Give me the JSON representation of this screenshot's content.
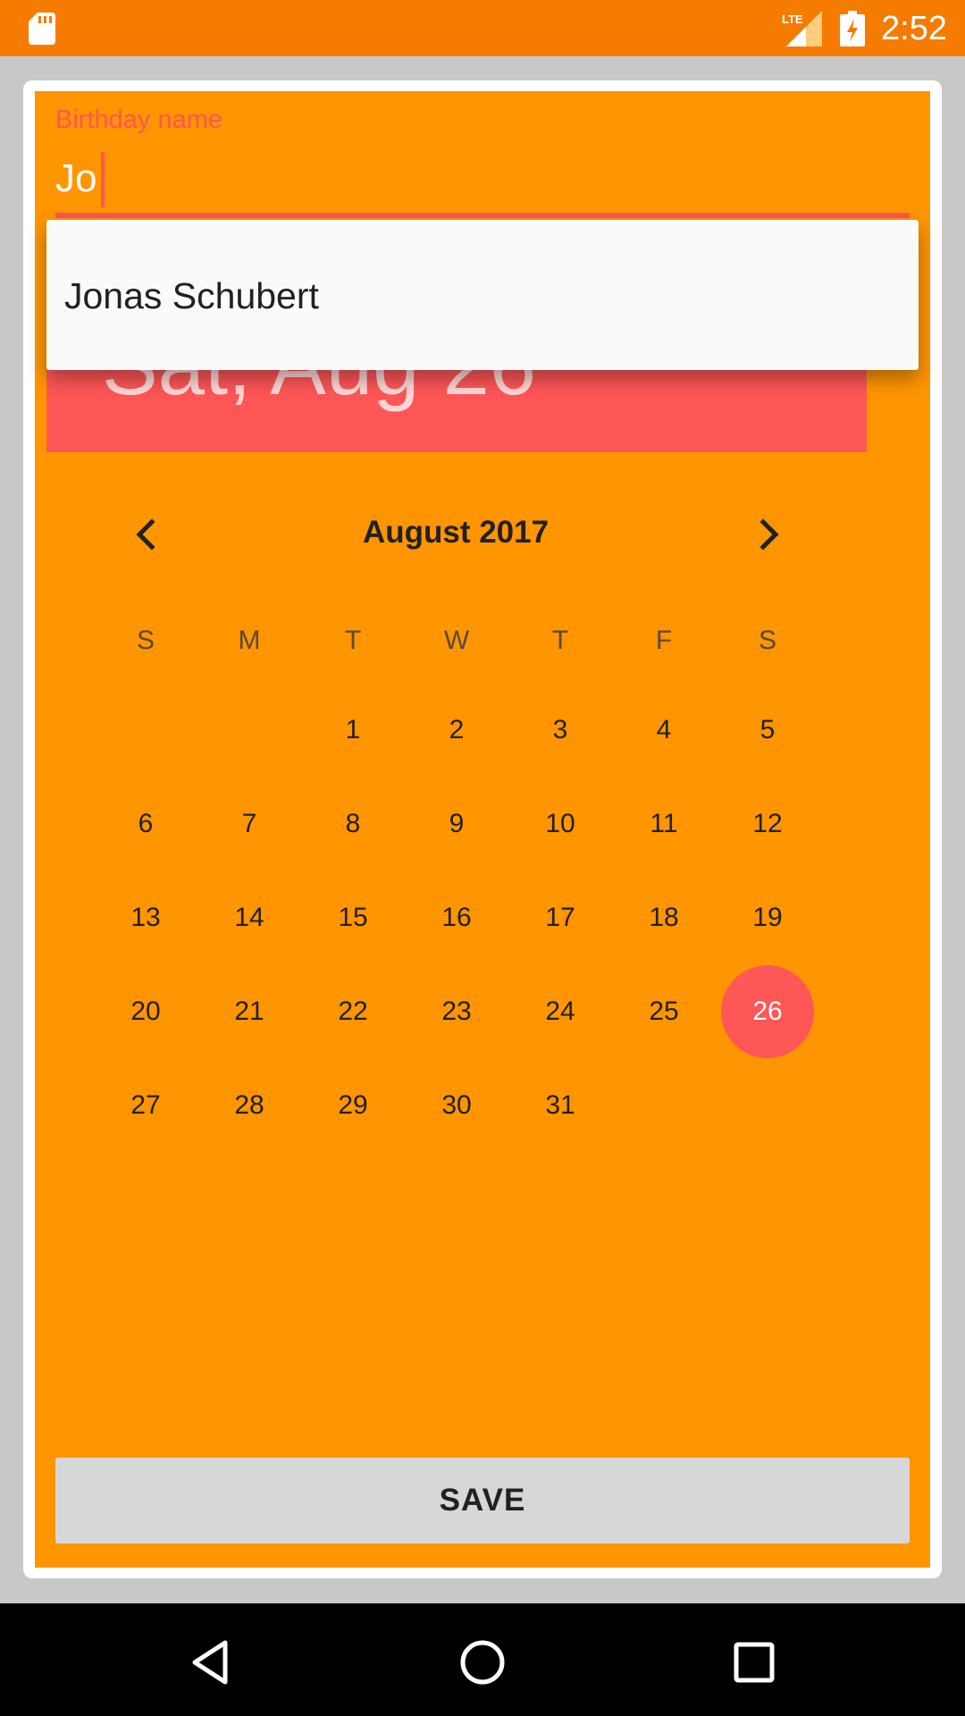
{
  "status_bar": {
    "time": "2:52",
    "network": "LTE",
    "icons": [
      "sd-card-icon",
      "lte-signal-icon",
      "battery-charging-icon"
    ]
  },
  "form": {
    "label": "Birthday name",
    "input_value": "Jo",
    "accent_color": "#ff5656",
    "background_color": "#ff9500"
  },
  "autocomplete": {
    "suggestions": [
      "Jonas Schubert"
    ]
  },
  "date_picker": {
    "header_date": "Sat, Aug 26",
    "month_label": "August 2017",
    "weekdays": [
      "S",
      "M",
      "T",
      "W",
      "T",
      "F",
      "S"
    ],
    "days": [
      "1",
      "2",
      "3",
      "4",
      "5",
      "6",
      "7",
      "8",
      "9",
      "10",
      "11",
      "12",
      "13",
      "14",
      "15",
      "16",
      "17",
      "18",
      "19",
      "20",
      "21",
      "22",
      "23",
      "24",
      "25",
      "26",
      "27",
      "28",
      "29",
      "30",
      "31"
    ],
    "selected_day": "26",
    "prev_icon": "chevron-left-icon",
    "next_icon": "chevron-right-icon"
  },
  "actions": {
    "save_label": "SAVE"
  },
  "nav_bar": {
    "icons": [
      "back-icon",
      "home-icon",
      "recents-icon"
    ]
  }
}
